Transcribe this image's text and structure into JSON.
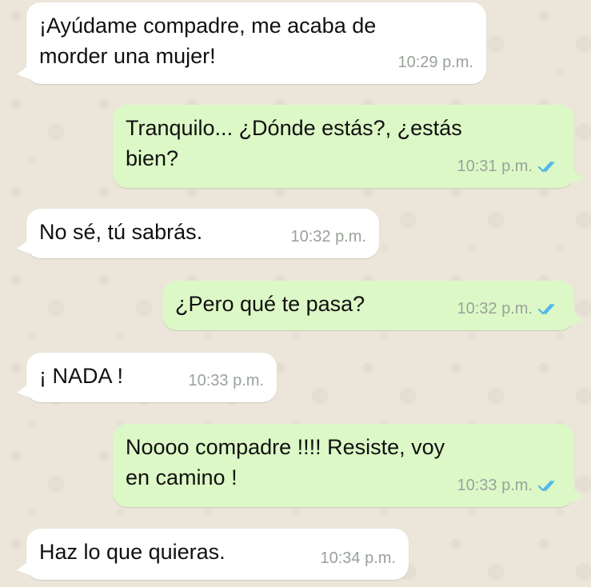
{
  "messages": [
    {
      "direction": "in",
      "text": "¡Ayúdame compadre, me acaba de\nmorder una mujer!",
      "time": "10:29 p.m."
    },
    {
      "direction": "out",
      "text": "Tranquilo... ¿Dónde estás?, ¿estás\nbien?",
      "time": "10:31 p.m.",
      "status": "read"
    },
    {
      "direction": "in",
      "text": "No sé, tú sabrás.",
      "time": "10:32 p.m."
    },
    {
      "direction": "out",
      "text": "¿Pero qué te pasa?",
      "time": "10:32 p.m.",
      "status": "read"
    },
    {
      "direction": "in",
      "text": "¡ NADA !",
      "time": "10:33 p.m."
    },
    {
      "direction": "out",
      "text": "Noooo compadre !!!! Resiste, voy\nen camino !",
      "time": "10:33 p.m.",
      "status": "read"
    },
    {
      "direction": "in",
      "text": "Haz lo que quieras.",
      "time": "10:34 p.m."
    }
  ],
  "colors": {
    "incoming_bubble": "#ffffff",
    "outgoing_bubble": "#dcf8c6",
    "read_tick": "#4fb6ec",
    "time_text": "#9aa29a"
  }
}
